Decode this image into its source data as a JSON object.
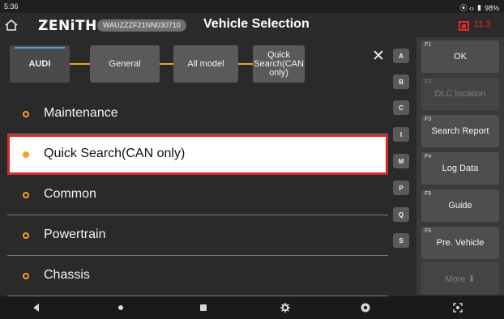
{
  "status_bar": {
    "time": "5:36",
    "battery": "98%"
  },
  "header": {
    "brand": "ZENiTH",
    "vin": "WAUZZZF21NN030710",
    "title": "Vehicle Selection",
    "alert_count": "11.3"
  },
  "breadcrumbs": [
    {
      "label": "AUDI"
    },
    {
      "label": "General"
    },
    {
      "label": "All model"
    },
    {
      "label": "Quick Search(CAN only)"
    }
  ],
  "list": {
    "items": [
      {
        "label": "Maintenance"
      },
      {
        "label": "Quick Search(CAN only)",
        "selected": true
      },
      {
        "label": "Common"
      },
      {
        "label": "Powertrain"
      },
      {
        "label": "Chassis"
      }
    ]
  },
  "alphabet": [
    "A",
    "B",
    "C",
    "I",
    "M",
    "P",
    "Q",
    "S"
  ],
  "function_keys": [
    {
      "key": "F1",
      "label": "OK"
    },
    {
      "key": "F2",
      "label": "DLC location",
      "disabled": true
    },
    {
      "key": "F3",
      "label": "Search Report"
    },
    {
      "key": "F4",
      "label": "Log Data"
    },
    {
      "key": "F5",
      "label": "Guide"
    },
    {
      "key": "F6",
      "label": "Pre. Vehicle"
    },
    {
      "key": "",
      "label": "More ⬇",
      "disabled": true
    }
  ],
  "colors": {
    "accent": "#f2a324",
    "alert": "#e8262c",
    "selection_border": "#d8262c"
  }
}
